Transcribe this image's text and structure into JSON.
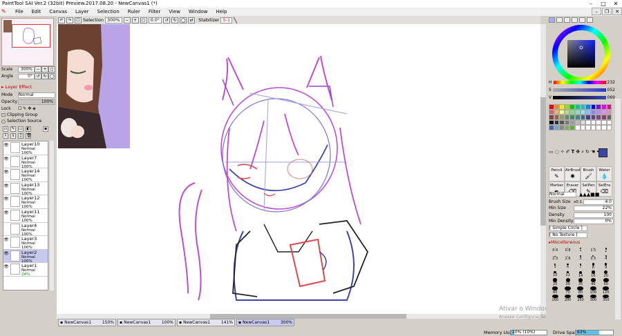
{
  "window": {
    "title": "PaintTool SAI Ver.2 (32bit) Preview.2017.08.20 - NewCanvas1 (*)"
  },
  "menu": [
    "File",
    "Edit",
    "Canvas",
    "Layer",
    "Selection",
    "Ruler",
    "Filter",
    "View",
    "Window",
    "Help"
  ],
  "toolbar": {
    "selection_label": "Selection",
    "zoom": "300%",
    "angle": "0.0°",
    "stabilizer_label": "Stabilizer",
    "stabilizer_value": "S-1"
  },
  "navigator": {
    "scale_label": "Scale",
    "scale_value": "300%",
    "angle_label": "Angle",
    "angle_value": "0°"
  },
  "layer_effect": {
    "header": "Layer Effect",
    "mode_label": "Mode",
    "mode_value": "Normal",
    "opacity_label": "Opacity",
    "opacity_value": "100%",
    "lock_label": "Lock",
    "clipping_label": "Clipping Group",
    "selection_source_label": "Selection Source"
  },
  "layers": [
    {
      "name": "Layer10",
      "mode": "Normal",
      "opacity": "100%",
      "visible": true,
      "selected": false
    },
    {
      "name": "Layer7",
      "mode": "Normal",
      "opacity": "100%",
      "visible": true,
      "selected": false
    },
    {
      "name": "Layer14",
      "mode": "Normal",
      "opacity": "100%",
      "visible": true,
      "selected": false
    },
    {
      "name": "Layer13",
      "mode": "Normal",
      "opacity": "100%",
      "visible": true,
      "selected": false
    },
    {
      "name": "Layer12",
      "mode": "Normal",
      "opacity": "100%",
      "visible": true,
      "selected": false
    },
    {
      "name": "Layer11",
      "mode": "Normal",
      "opacity": "100%",
      "visible": true,
      "selected": false
    },
    {
      "name": "Layer4",
      "mode": "Normal",
      "opacity": "100%",
      "visible": false,
      "selected": false
    },
    {
      "name": "Layer3",
      "mode": "Normal",
      "opacity": "100%",
      "visible": true,
      "selected": false
    },
    {
      "name": "Layer2",
      "mode": "Normal",
      "opacity": "100%",
      "visible": true,
      "selected": true
    },
    {
      "name": "Layer1",
      "mode": "Normal",
      "opacity": "24%",
      "visible": true,
      "selected": false
    }
  ],
  "color": {
    "h_label": "H",
    "h_value": "232",
    "s_label": "S",
    "s_value": "052",
    "v_label": "V",
    "v_value": "069",
    "current": "#3a44b0"
  },
  "tools": [
    {
      "name": "Pencil",
      "icon": "pencil-icon"
    },
    {
      "name": "AirBrush",
      "icon": "airbrush-icon"
    },
    {
      "name": "Brush",
      "icon": "brush-icon"
    },
    {
      "name": "Water",
      "icon": "water-icon"
    },
    {
      "name": "Marker",
      "icon": "marker-icon"
    },
    {
      "name": "Eraser",
      "icon": "eraser-icon"
    },
    {
      "name": "SelPen",
      "icon": "selpen-icon"
    },
    {
      "name": "SelEra",
      "icon": "selera-icon"
    }
  ],
  "brush": {
    "mode_value": "Normal",
    "size_label": "Brush Size",
    "size_mult": "x0.1",
    "size_value": "4.0",
    "min_size_label": "Min Size",
    "min_size_value": "22%",
    "density_label": "Density",
    "density_value": "100",
    "min_density_label": "Min Density",
    "min_density_value": "0%",
    "shape_value": "[ Simple Circle ]",
    "texture_value": "[ No Texture ]",
    "misc_label": "Miscellaneous"
  },
  "brush_sizes": [
    "0.4",
    "0.8",
    "1",
    "1.5",
    "2",
    "2.3",
    "2.6",
    "3",
    "3.5",
    "4",
    "5",
    "6",
    "7",
    "8",
    "9",
    "10",
    "12",
    "14",
    "16",
    "20",
    "25",
    "30",
    "35",
    "40",
    "50",
    "60",
    "70",
    "80",
    "100",
    "120",
    "160",
    "200",
    "250",
    "300",
    "350"
  ],
  "canvas_tabs": [
    {
      "name": "NewCanvas1",
      "zoom": "150%"
    },
    {
      "name": "NewCanvas1",
      "zoom": "100%"
    },
    {
      "name": "NewCanvas1",
      "zoom": "141%"
    },
    {
      "name": "NewCanvas1",
      "zoom": "300%"
    }
  ],
  "status": {
    "memory_label": "Memory Usage",
    "memory_value": "10% (10%)",
    "memory_fraction": 0.1,
    "drive_label": "Drive Space",
    "drive_value": "63%",
    "drive_fraction": 0.63
  },
  "watermark": {
    "line1": "Ativar o Windows",
    "line2": "Acesse Configurações"
  }
}
